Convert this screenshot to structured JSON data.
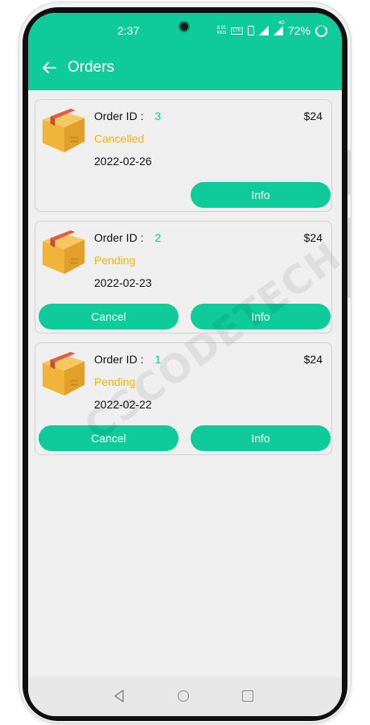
{
  "status_bar": {
    "time": "2:37",
    "net_speed_value": "8.91",
    "net_speed_unit": "KB/S",
    "lte_label": "LTE",
    "battery": "72%",
    "signal_label": "4G"
  },
  "app_bar": {
    "title": "Orders",
    "back_icon": "arrow-left-icon"
  },
  "colors": {
    "primary": "#0fcb99",
    "status_yellow": "#f4b400",
    "background": "#efefef"
  },
  "orders": [
    {
      "label": "Order ID :",
      "id": "3",
      "status": "Cancelled",
      "date": "2022-02-26",
      "price": "$24",
      "buttons": {
        "info": "Info"
      }
    },
    {
      "label": "Order ID :",
      "id": "2",
      "status": "Pending",
      "date": "2022-02-23",
      "price": "$24",
      "buttons": {
        "cancel": "Cancel",
        "info": "Info"
      }
    },
    {
      "label": "Order ID :",
      "id": "1",
      "status": "Pending",
      "date": "2022-02-22",
      "price": "$24",
      "buttons": {
        "cancel": "Cancel",
        "info": "Info"
      }
    }
  ],
  "watermark": "CSCODETECH",
  "nav_bar": {
    "icons": [
      "back-triangle-icon",
      "home-circle-icon",
      "recents-square-icon"
    ]
  }
}
